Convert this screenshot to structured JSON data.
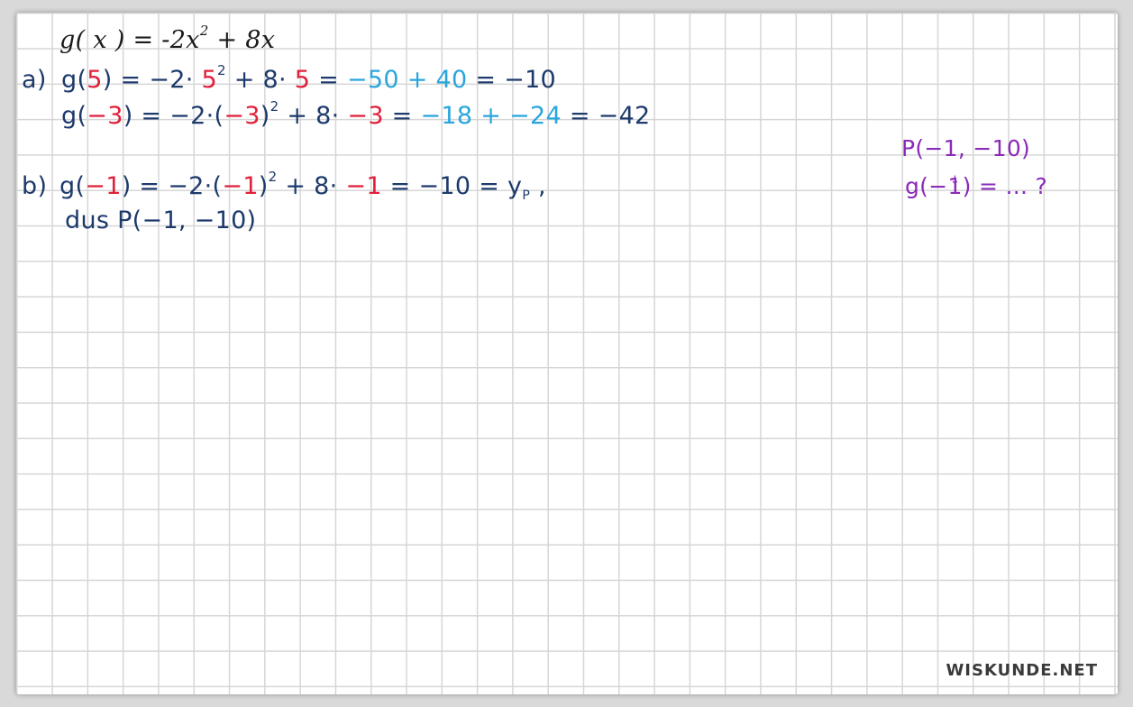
{
  "definition": {
    "label": "",
    "func": "g",
    "lp": "(",
    "x": " x ",
    "rp": ")",
    "eq": " = ",
    "coef": "-2x",
    "exp": "2",
    "rest": " + 8x"
  },
  "part_a": {
    "label": "a)",
    "line1": {
      "g": "g",
      "lp": "(",
      "arg": "5",
      "rp": ")",
      "eq1": " = −2· ",
      "base": "5",
      "exp": "2",
      "mid": " + 8· ",
      "arg2": "5",
      "eq2": " = ",
      "blue": "−50 + 40",
      "eq3": " = −10"
    },
    "line2": {
      "g": "g",
      "lp": "(",
      "arg": "−3",
      "rp": ")",
      "eq1": " = −2·(",
      "base": "−3",
      "rp2": ")",
      "exp": "2",
      "mid": " + 8· ",
      "arg2": "−3",
      "eq2": " = ",
      "blue": "−18 + −24",
      "eq3": " = −42"
    }
  },
  "part_b": {
    "label": "b)",
    "line1": {
      "g": "g",
      "lp": "(",
      "arg": "−1",
      "rp": ")",
      "eq1": " = −2·(",
      "base": "−1",
      "rp2": ")",
      "exp": "2",
      "mid": " + 8· ",
      "arg2": "−1",
      "eq2": " = −10 = y",
      "sub": "P",
      "tail": " ,"
    },
    "line2": "dus  P(−1, −10)"
  },
  "side_note": {
    "line1": "P(−1, −10)",
    "line2": "g(−1) =  ... ?"
  },
  "watermark": "WISKUNDE.NET",
  "colors": {
    "ink_dark": "#1d3a6b",
    "ink_red": "#e0203a",
    "ink_blue": "#2aa6dc",
    "ink_purple": "#8a2ab8"
  }
}
